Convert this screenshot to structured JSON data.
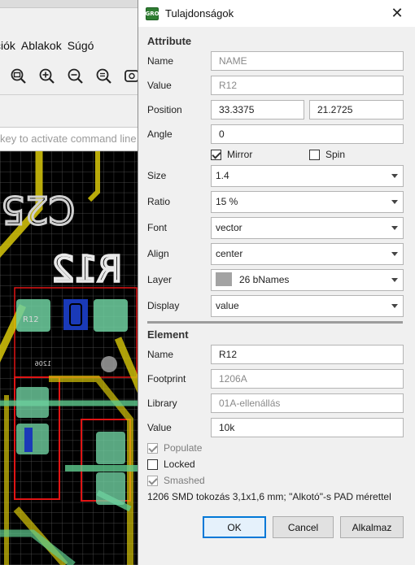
{
  "background_app": {
    "menu": [
      "ciók",
      "Ablakok",
      "Súgó"
    ],
    "cmdline_placeholder": "key to activate command line m",
    "board_labels": [
      "C25",
      "R12",
      "R12",
      "1206"
    ]
  },
  "dialog": {
    "title": "Tulajdonságok",
    "attribute": {
      "section_title": "Attribute",
      "name_label": "Name",
      "name_value": "NAME",
      "value_label": "Value",
      "value_value": "R12",
      "position_label": "Position",
      "position_x": "33.3375",
      "position_y": "21.2725",
      "angle_label": "Angle",
      "angle_value": "0",
      "mirror_label": "Mirror",
      "mirror_checked": true,
      "spin_label": "Spin",
      "spin_checked": false,
      "size_label": "Size",
      "size_value": "1.4",
      "ratio_label": "Ratio",
      "ratio_value": "15 %",
      "font_label": "Font",
      "font_value": "vector",
      "align_label": "Align",
      "align_value": "center",
      "layer_label": "Layer",
      "layer_value": "26 bNames",
      "layer_color": "#a3a3a3",
      "display_label": "Display",
      "display_value": "value"
    },
    "element": {
      "section_title": "Element",
      "name_label": "Name",
      "name_value": "R12",
      "footprint_label": "Footprint",
      "footprint_value": "1206A",
      "library_label": "Library",
      "library_value": "01A-ellenállás",
      "value_label": "Value",
      "value_value": "10k",
      "populate_label": "Populate",
      "populate_checked": true,
      "locked_label": "Locked",
      "locked_checked": false,
      "smashed_label": "Smashed",
      "smashed_checked": true,
      "description": "1206 SMD tokozás 3,1x1,6 mm; \"Alkotó\"-s PAD mérettel"
    },
    "buttons": {
      "ok": "OK",
      "cancel": "Cancel",
      "apply": "Alkalmaz"
    }
  }
}
